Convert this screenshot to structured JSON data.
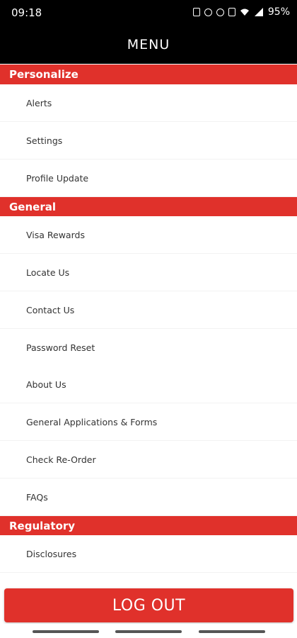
{
  "status_bar": {
    "time": "09:18",
    "battery": "95%",
    "icons": [
      "lock-icon",
      "alarm-icon",
      "bluetooth-icon",
      "mute-icon",
      "wifi-icon",
      "signal-icon"
    ]
  },
  "header": {
    "title": "MENU"
  },
  "sections": {
    "personalize": {
      "title": "Personalize",
      "items": [
        "Alerts",
        "Settings",
        "Profile Update"
      ]
    },
    "general": {
      "title": "General",
      "items": [
        "Visa Rewards",
        "Locate Us",
        "Contact Us",
        "Password Reset",
        "About Us",
        "General Applications & Forms",
        "Check Re-Order",
        "FAQs"
      ]
    },
    "regulatory": {
      "title": "Regulatory",
      "items": [
        "Disclosures"
      ]
    }
  },
  "logout_label": "LOG OUT",
  "colors": {
    "accent": "#e0312b",
    "header_bg": "#000000"
  }
}
